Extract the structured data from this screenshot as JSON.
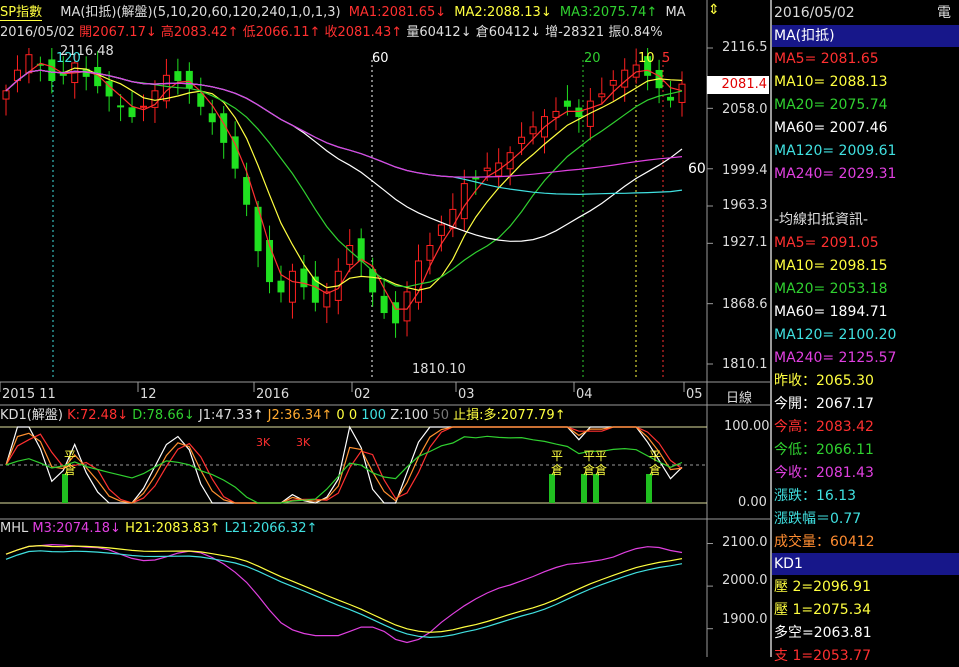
{
  "header_main": {
    "index_name": "SP指數",
    "ma_name": "MA(扣抵)(解盤)(5,10,20,60,120,240,1,0,1,3)",
    "ma1": "MA1:2081.65",
    "ma2": "MA2:2088.13",
    "ma3": "MA3:2075.74",
    "ma_more": "MA",
    "date": "2016/05/02",
    "open": "開2067.17",
    "high": "高2083.42",
    "low": "低2066.11",
    "close": "收2081.43",
    "volume": "量60412",
    "position": "倉60412",
    "change": "增-28321",
    "amplitude": "振0.84%"
  },
  "header_kd": {
    "name": "KD1(解盤)",
    "k": "K:72.48",
    "d": "D:78.66",
    "j1": "J1:47.33",
    "j2": "J2:36.34",
    "z_a": "0",
    "z_b": "0",
    "z_c": "100",
    "z": "Z:100",
    "z_d": "50",
    "stop_loss": "止損:多:2077.79"
  },
  "header_mhl": {
    "name": "MHL",
    "m3": "M3:2074.18",
    "h21": "H21:2083.83",
    "l21": "L21:2066.32"
  },
  "x_axis": {
    "labels": [
      "2015 11",
      "12",
      "2016",
      "02",
      "03",
      "04",
      "05"
    ],
    "unit": "日線"
  },
  "price_axis": {
    "ticks": [
      "2116.5",
      "2058.0",
      "1999.4",
      "1963.3",
      "1927.1",
      "1868.6",
      "1810.1"
    ],
    "current": "2081.4"
  },
  "kd_axis": {
    "ticks": [
      "100.00",
      "0.00"
    ]
  },
  "mhl_axis": {
    "ticks": [
      "2100.0",
      "2000.0",
      "1900.0"
    ]
  },
  "annotations": {
    "high_label": "2116.48",
    "low_label": "1810.10",
    "ma60_label": "60",
    "v_120": "120",
    "v_60": "60",
    "v_20": "20",
    "v_10": "10",
    "v_5": "5",
    "kd_signal": "平",
    "kd_signal2": "倉",
    "kd_3k": "3K"
  },
  "right_panel": {
    "date": "2016/05/02",
    "extra": "電",
    "ma_title": "MA(扣抵)",
    "ma5": "MA5= 2081.65",
    "ma10": "MA10= 2088.13",
    "ma20": "MA20= 2075.74",
    "ma60": "MA60= 2007.46",
    "ma120": "MA120= 2009.61",
    "ma240": "MA240= 2029.31",
    "deduct_title": "-均線扣抵資訊-",
    "d_ma5": "MA5= 2091.05",
    "d_ma10": "MA10= 2098.15",
    "d_ma20": "MA20= 2053.18",
    "d_ma60": "MA60= 1894.71",
    "d_ma120": "MA120= 2100.20",
    "d_ma240": "MA240= 2125.57",
    "prev_close": "昨收：2065.30",
    "open": "今開：2067.17",
    "high": "今高：2083.42",
    "low": "今低：2066.11",
    "close": "今收：2081.43",
    "change": "漲跌：16.13",
    "change_pct": "漲跌幅＝0.77",
    "volume": "成交量：60412",
    "kd_title": "KD1",
    "r2": "壓 2=2096.91",
    "r1": "壓 1=2075.34",
    "pivot": "多空=2063.81",
    "s1": "支 1=2053.77"
  },
  "colors": {
    "up": "#ff2020",
    "down": "#20e020",
    "ma5": "#ff3030",
    "ma10": "#ffff40",
    "ma20": "#30d030",
    "ma60": "#ffffff",
    "ma120": "#40e0e0",
    "ma240": "#e040e0"
  },
  "chart_data": {
    "type": "line",
    "title": "SP指數",
    "price_range": [
      1810.1,
      2116.5
    ],
    "months": [
      "2015/11",
      "2015/12",
      "2016/01",
      "2016/02",
      "2016/03",
      "2016/04",
      "2016/05"
    ],
    "close": [
      2075,
      2095,
      2110,
      2100,
      2085,
      2090,
      2102,
      2089,
      2080,
      2070,
      2060,
      2050,
      2060,
      2075,
      2090,
      2085,
      2078,
      2060,
      2045,
      2025,
      2000,
      1965,
      1920,
      1890,
      1880,
      1900,
      1885,
      1870,
      1880,
      1900,
      1925,
      1910,
      1880,
      1860,
      1850,
      1880,
      1910,
      1925,
      1945,
      1960,
      1985,
      1990,
      2000,
      2005,
      2015,
      2030,
      2040,
      2050,
      2055,
      2060,
      2050,
      2065,
      2072,
      2085,
      2095,
      2100,
      2090,
      2078,
      2066,
      2081.43
    ],
    "series": [
      {
        "name": "MA5",
        "last": 2081.65
      },
      {
        "name": "MA10",
        "last": 2088.13
      },
      {
        "name": "MA20",
        "last": 2075.74
      },
      {
        "name": "MA60",
        "last": 2007.46
      },
      {
        "name": "MA120",
        "last": 2009.61
      },
      {
        "name": "MA240",
        "last": 2029.31
      }
    ],
    "high": 2116.48,
    "low": 1810.1
  }
}
